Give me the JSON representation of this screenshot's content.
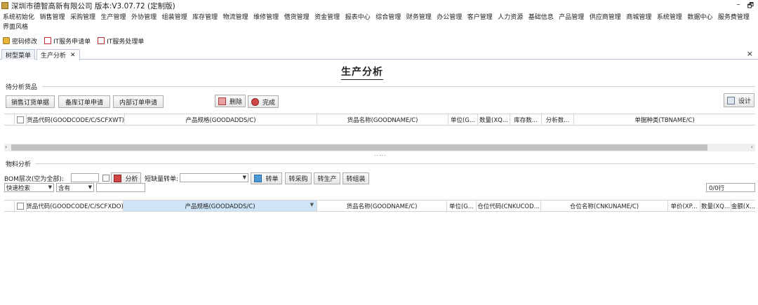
{
  "window": {
    "title": "深圳市德智高新有限公司 版本:V3.07.72 (定制版)",
    "restore_glyph": "🗗",
    "minimize_glyph": "–"
  },
  "menu": {
    "row1": [
      "系统初始化",
      "销售管理",
      "采购管理",
      "生产管理",
      "外协管理",
      "组装管理",
      "库存管理",
      "物流管理",
      "维修管理",
      "借货管理",
      "资金管理",
      "报表中心",
      "综合管理",
      "财务管理",
      "办公管理",
      "客户管理",
      "人力资源",
      "基础信息",
      "产品管理",
      "供应商管理",
      "商城管理",
      "系统管理",
      "数据中心",
      "服务费管理"
    ],
    "row2": [
      "界面风格"
    ]
  },
  "quickbar": {
    "items": [
      {
        "label": "密码修改",
        "icon": "lock-icon"
      },
      {
        "label": "IT服务申请单",
        "icon": "form-icon"
      },
      {
        "label": "IT服务处理单",
        "icon": "form-icon"
      }
    ]
  },
  "tabs": [
    {
      "label": "树型菜单",
      "active": false
    },
    {
      "label": "生产分析",
      "active": true,
      "close": "✕"
    }
  ],
  "panel_close": "×",
  "page": {
    "title": "生产分析"
  },
  "section1": {
    "label": "待分析货品",
    "buttons": {
      "sales": "销售订货单据",
      "stock": "备库订单申请",
      "internal": "内部订单申请",
      "delete": "删除",
      "done": "完成",
      "design": "设计"
    },
    "columns": [
      "货品代码(GOODCODE/C/SCFXWT)",
      "产品规格(GOODADDS/C)",
      "货品名称(GOODNAME/C)",
      "单位(G...",
      "数量(XQ...",
      "库存数...",
      "分析数...",
      "单据种类(TBNAME/C)"
    ]
  },
  "scroll": {
    "left_arrow": "‹",
    "right_arrow": "›",
    "splitter": "....."
  },
  "section2": {
    "label": "物料分析",
    "bom_label": "BOM层次(空为全部):",
    "analyze_label": "分析",
    "shortage_label": "短缺量转单:",
    "buttons": {
      "transfer": "转单",
      "to_purchase": "转采购",
      "to_production": "转生产",
      "to_assembly": "转组装"
    },
    "search_type": "快速检索",
    "search_op": "含有",
    "search_value": "",
    "record_count": "0/0行",
    "columns": [
      "货品代码(GOODCODE/C/SCFXDO)",
      "产品规格(GOODADDS/C)",
      "货品名称(GOODNAME/C)",
      "单位(G...",
      "仓位代码(CNKUCOD...",
      "仓位名称(CNKUNAME/C)",
      "单价(XP...",
      "数量(XQ...",
      "金额(X..."
    ]
  },
  "colors": {
    "accent": "#4a9ad8",
    "highlight_column": "#cfe4f7",
    "border": "#d6d6d6"
  }
}
